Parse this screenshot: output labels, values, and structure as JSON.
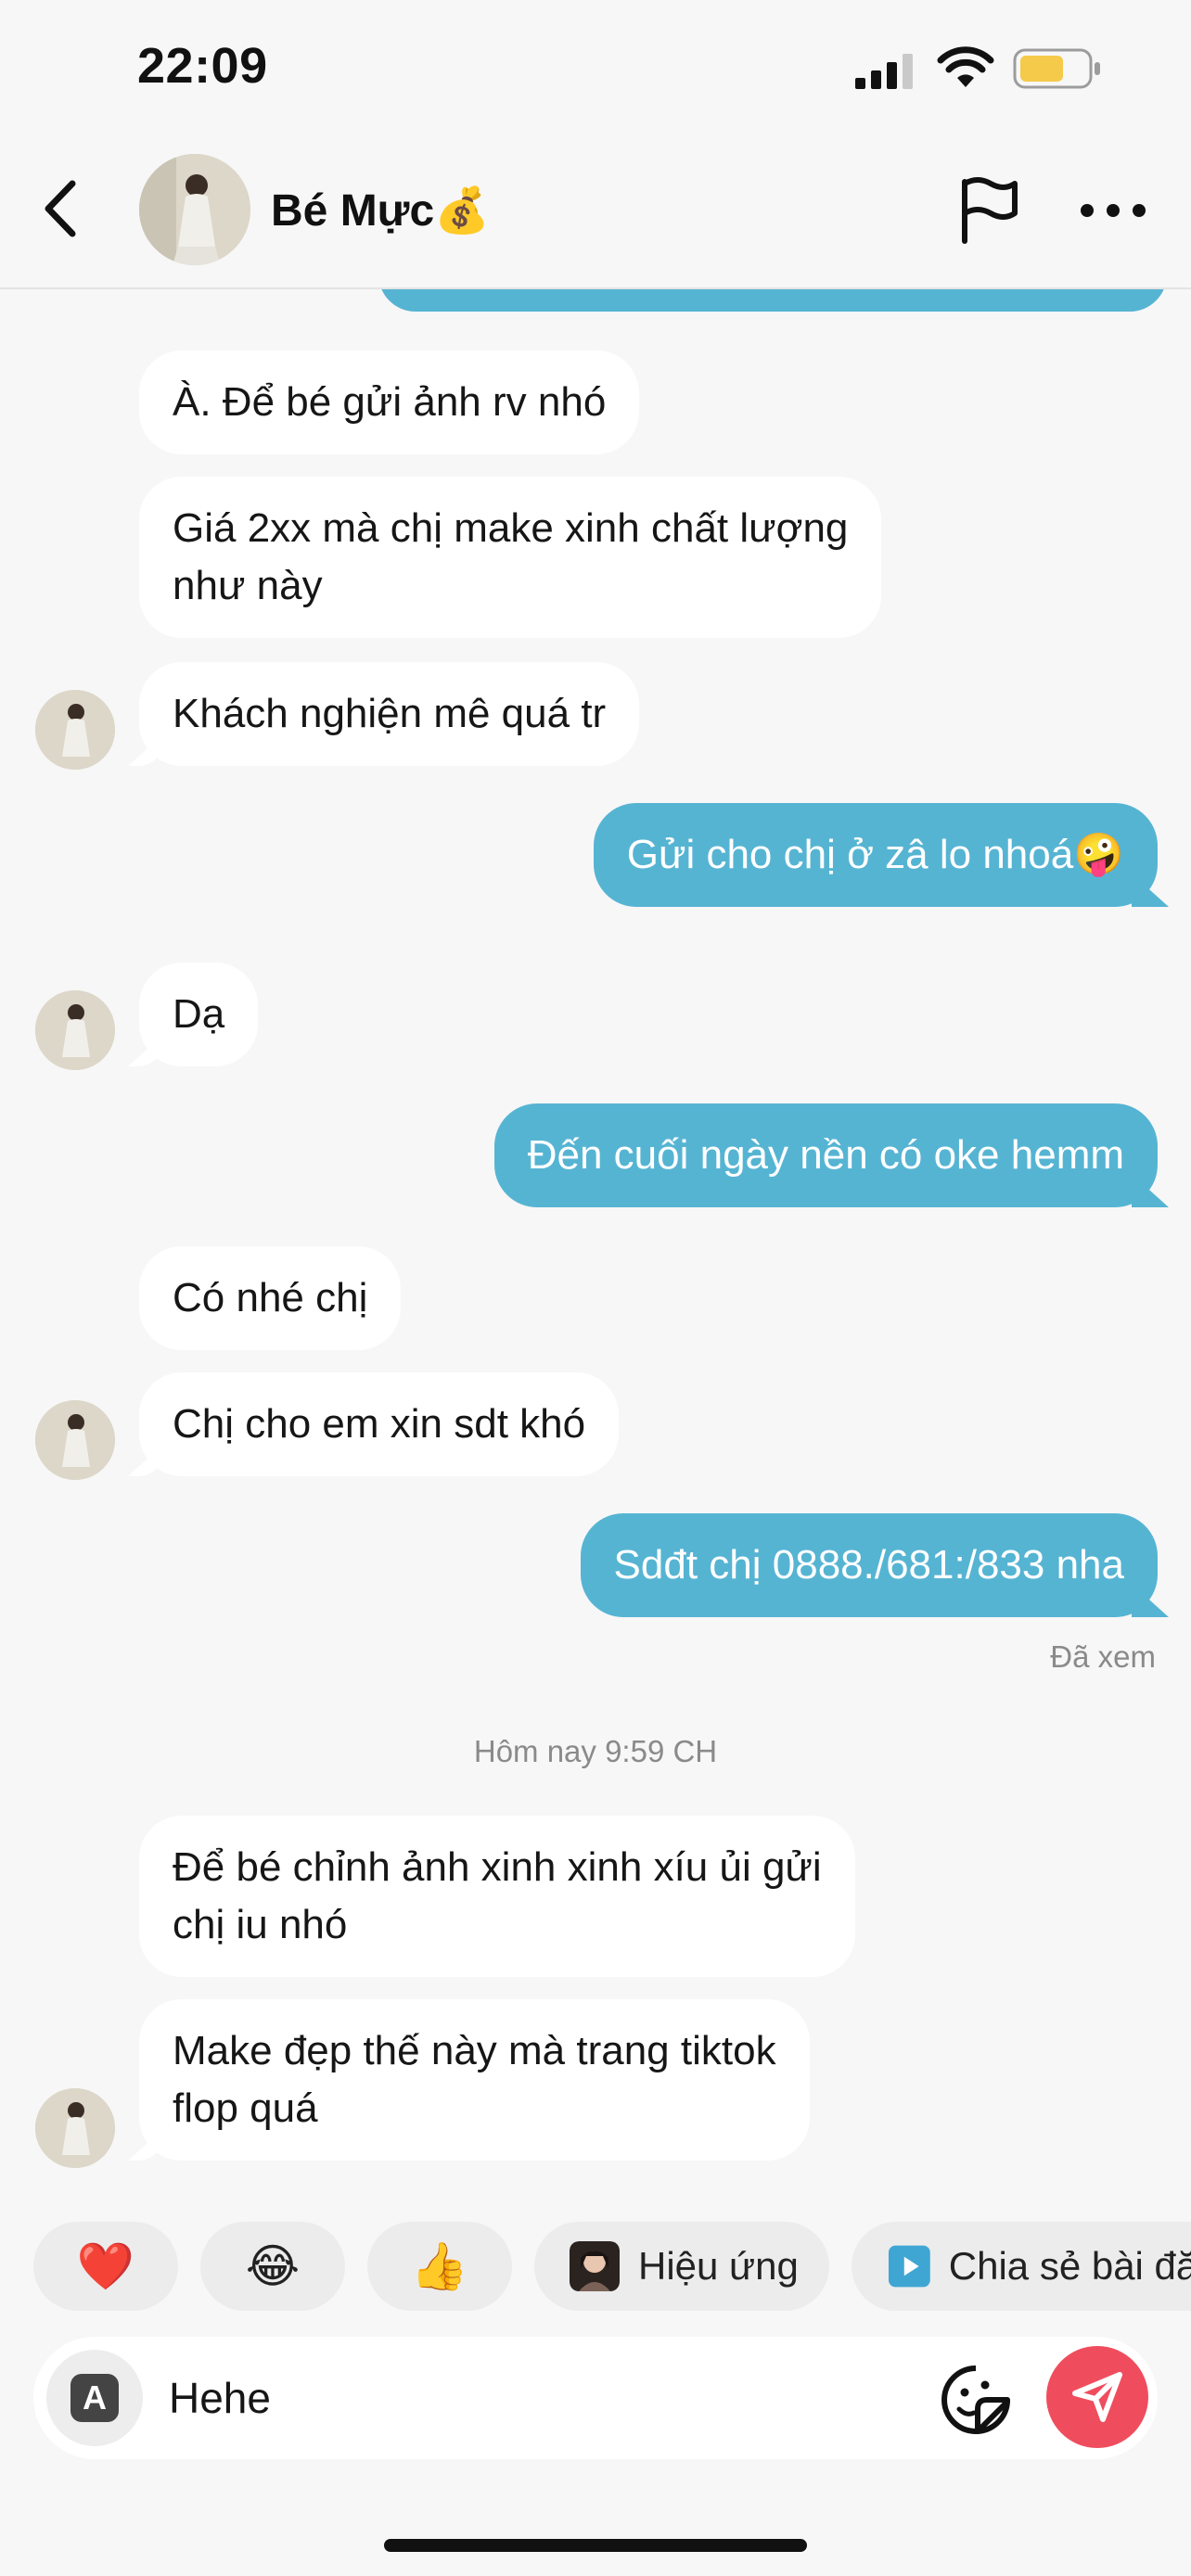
{
  "status_bar": {
    "time": "22:09"
  },
  "header": {
    "contact_name": "Bé Mực",
    "name_emoji": "💰"
  },
  "messages": [
    {
      "id": "m1",
      "from": "them",
      "text": "À. Để bé gửi ảnh rv nhó"
    },
    {
      "id": "m2",
      "from": "them",
      "lines": [
        "Giá 2xx mà chị make xinh chất lượng",
        "như này"
      ]
    },
    {
      "id": "m3",
      "from": "them",
      "text": "Khách nghiện mê quá tr"
    },
    {
      "id": "m4",
      "from": "me",
      "text": "Gửi cho chị ở zâ lo nhoá🤪"
    },
    {
      "id": "m5",
      "from": "them",
      "text": "Dạ"
    },
    {
      "id": "m6",
      "from": "me",
      "text": "Đến cuối ngày nền có oke hemm"
    },
    {
      "id": "m7",
      "from": "them",
      "text": "Có nhé chị"
    },
    {
      "id": "m8",
      "from": "them",
      "text": "Chị cho em xin sdt khó"
    },
    {
      "id": "m9",
      "from": "me",
      "text": "Sdđt chị 0888./681:/833 nha"
    },
    {
      "id": "m10",
      "from": "them",
      "lines": [
        "Để bé chỉnh ảnh xinh xinh xíu ủi gửi",
        "chị iu nhó"
      ]
    },
    {
      "id": "m11",
      "from": "them",
      "lines": [
        "Make đẹp thế này mà trang tiktok",
        "flop quá"
      ]
    }
  ],
  "seen_status": "Đã xem",
  "day_separator": "Hôm nay 9:59 CH",
  "quick_replies": [
    {
      "label": "",
      "glyph": "❤️"
    },
    {
      "label": "",
      "glyph": "😂"
    },
    {
      "label": "",
      "glyph": "👍"
    },
    {
      "label": "Hiệu ứng",
      "icon": "effect-thumbnail"
    },
    {
      "label": "Chia sẻ bài đăng",
      "icon": "play-icon"
    }
  ],
  "input": {
    "value": "Hehe",
    "keyboard_label": "A"
  },
  "colors": {
    "sent_bubble": "#56b4d3",
    "received_bubble": "#ffffff",
    "send_button": "#ef4d5e",
    "background": "#f7f7f7"
  }
}
